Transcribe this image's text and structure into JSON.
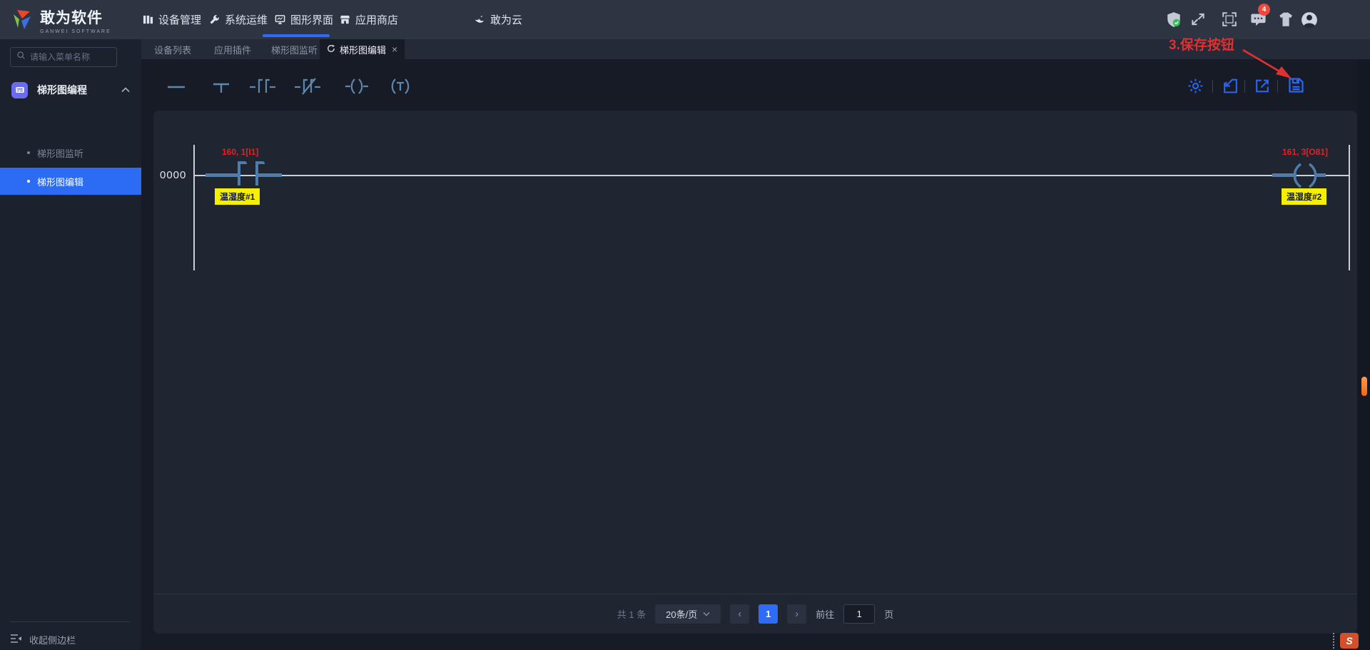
{
  "colors": {
    "accent_blue": "#2e6bf6",
    "ladder_blue": "#4d7dac",
    "annotation_red": "#e03131",
    "address_red": "#e32222",
    "tag_yellow": "#f5ef00",
    "scroll_orange": "#ef661d"
  },
  "navbar": {
    "logo_title": "敢为软件",
    "logo_subtitle": "GANWEI SOFTWARE",
    "items": [
      {
        "label": "设备管理"
      },
      {
        "label": "系统运维"
      },
      {
        "label": "图形界面",
        "active": true
      },
      {
        "label": "应用商店"
      },
      {
        "label": "敢为云"
      }
    ],
    "message_badge": "4"
  },
  "tab_bar": {
    "tabs": [
      {
        "label": "设备列表"
      },
      {
        "label": "应用插件"
      },
      {
        "label": "梯形图监听"
      },
      {
        "label": "梯形图编辑",
        "active": true
      }
    ],
    "close_glyph": "×"
  },
  "sidebar": {
    "search_placeholder": "请输入菜单名称",
    "group_label": "梯形图编程",
    "items": [
      {
        "label": "梯形图监听",
        "active": false
      },
      {
        "label": "梯形图编辑",
        "active": true
      }
    ],
    "collapse_label": "收起侧边栏"
  },
  "annotation": {
    "label": "3.保存按钮"
  },
  "editor": {
    "rung_number": "0000",
    "contact": {
      "address": "160, 1[I1]",
      "tag": "温湿度#1"
    },
    "coil": {
      "address": "161, 3[O81]",
      "tag": "温湿度#2"
    }
  },
  "pagination": {
    "total_label": "共 1 条",
    "page_size_label": "20条/页",
    "prev_glyph": "‹",
    "next_glyph": "›",
    "current_page": "1",
    "goto_label": "前往",
    "goto_value": "1",
    "unit_label": "页"
  },
  "widget": {
    "label": "S"
  }
}
